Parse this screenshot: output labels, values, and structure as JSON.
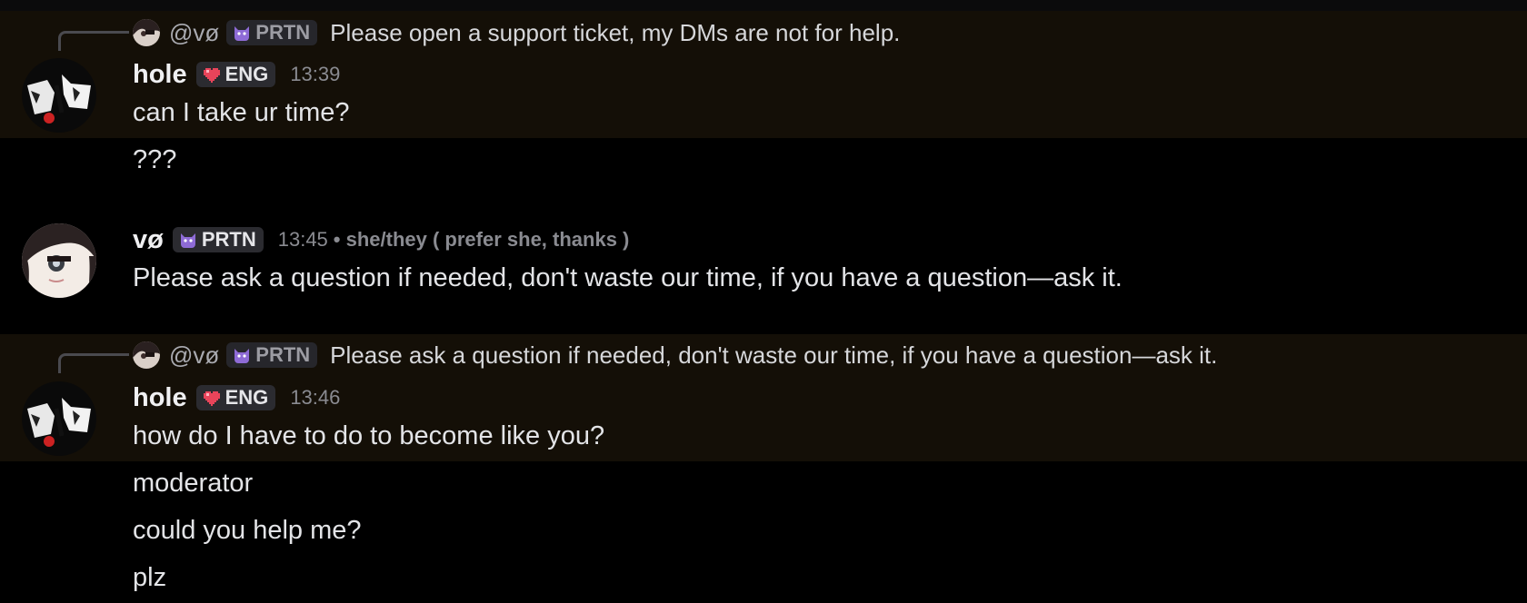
{
  "messages": [
    {
      "reply": {
        "mention": "@vø",
        "tag_label": "PRTN",
        "text": "Please open a support ticket, my DMs are not for help."
      },
      "author": "hole",
      "tag_label": "ENG",
      "time": "13:39",
      "lines": [
        "can I take ur time?",
        "???"
      ]
    },
    {
      "author": "vø",
      "tag_label": "PRTN",
      "time": "13:45",
      "pronouns": "• she/they ( prefer she, thanks )",
      "lines": [
        "Please ask a question if needed, don't waste our time, if you have a question—ask it."
      ]
    },
    {
      "reply": {
        "mention": "@vø",
        "tag_label": "PRTN",
        "text": "Please ask a question if needed, don't waste our time, if you have a question—ask it."
      },
      "author": "hole",
      "tag_label": "ENG",
      "time": "13:46",
      "lines": [
        "how do I have to do to become like you?",
        "moderator",
        "could you help me?",
        "plz"
      ]
    }
  ],
  "colors": {
    "background": "#000000",
    "highlight": "#140f07",
    "tag_bg": "#2b2b30",
    "timestamp": "#8a8b91"
  },
  "icons": {
    "eng_tag_icon": "pixel-heart-icon",
    "prtn_tag_icon": "purple-cat-icon"
  }
}
